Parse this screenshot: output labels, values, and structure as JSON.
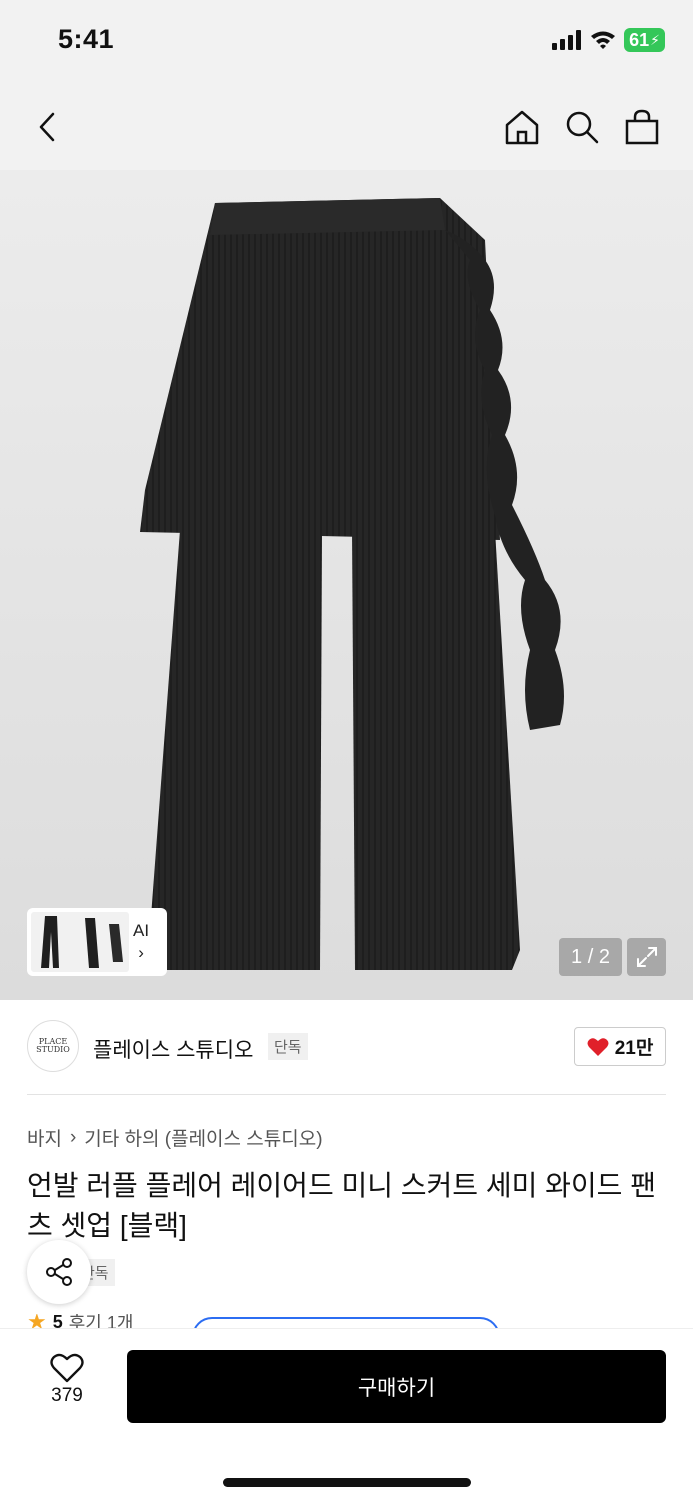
{
  "status_bar": {
    "time": "5:41",
    "battery": "61"
  },
  "nav": {
    "icons": [
      "back-icon",
      "home-icon",
      "search-icon",
      "shopping-bag-icon"
    ]
  },
  "gallery": {
    "ai_label": "AI",
    "page_indicator": "1 / 2"
  },
  "brand": {
    "logo_text": "PLACE STUDIO",
    "name": "플레이스 스튜디오",
    "badge": "단독",
    "like_count": "21만",
    "like_color": "#e0202a"
  },
  "product": {
    "breadcrumb": [
      "바지",
      "기타 하의 (플레이스 스튜디오)"
    ],
    "title": "언발 러플 플레어 레이어드 미니 스커트 세미 와이드 팬츠 셋업 [블랙]",
    "tag": "단독",
    "rating": "5",
    "review_text": "후기 1개",
    "star_color": "#f5a623"
  },
  "bottom_bar": {
    "wish_count": "379",
    "buy_label": "구매하기",
    "coupon_outline_color": "#2c6df2"
  }
}
